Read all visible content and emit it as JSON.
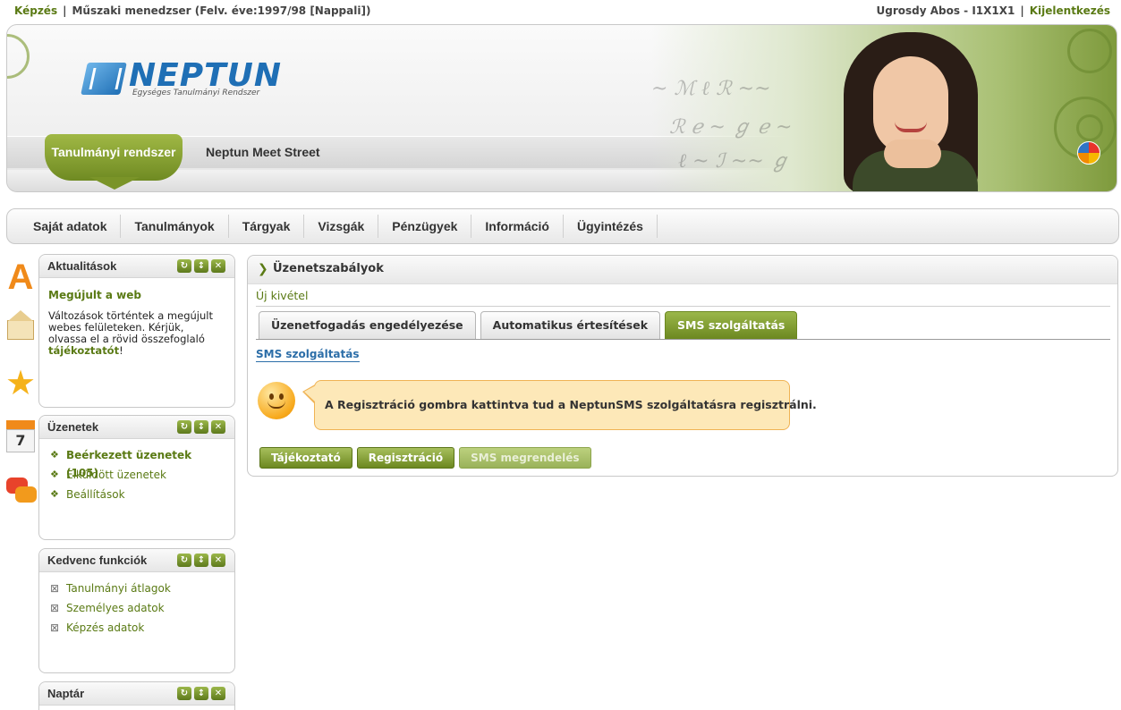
{
  "topbar": {
    "kepzes": "Képzés",
    "program": "Műszaki menedzser (Felv. éve:1997/98 [Nappali])",
    "user": "Ugrosdy Abos - I1X1X1",
    "logout": "Kijelentkezés"
  },
  "header": {
    "logo_text": "NEPTUN",
    "logo_tagline": "Egységes Tanulmányi Rendszer",
    "tab_active": "Tanulmányi rendszer",
    "tab_other": "Neptun Meet Street"
  },
  "menu": [
    "Saját adatok",
    "Tanulmányok",
    "Tárgyak",
    "Vizsgák",
    "Pénzügyek",
    "Információ",
    "Ügyintézés"
  ],
  "news": {
    "title": "Aktualitások",
    "item_title": "Megújult a web",
    "text_before": "Változások történtek a megújult webes felületeken. Kérjük, olvassa el a rövid összefoglaló ",
    "link": "tájékoztatót",
    "text_after": "!"
  },
  "messages": {
    "title": "Üzenetek",
    "items": [
      "Beérkezett üzenetek (105)",
      "Elküldött üzenetek",
      "Beállítások"
    ]
  },
  "favorites": {
    "title": "Kedvenc funkciók",
    "items": [
      "Tanulmányi átlagok",
      "Személyes adatok",
      "Képzés adatok"
    ]
  },
  "calendar": {
    "title": "Naptár"
  },
  "icons": {
    "calendar_day": "7"
  },
  "main": {
    "title": "Üzenetszabályok",
    "new_exception": "Új kivétel",
    "tabs": [
      "Üzenetfogadás engedélyezése",
      "Automatikus értesítések",
      "SMS szolgáltatás"
    ],
    "active_tab": 2,
    "subtitle": "SMS szolgáltatás",
    "info": "A Regisztráció gombra kattintva tud a NeptunSMS szolgáltatásra regisztrálni.",
    "buttons": [
      "Tájékoztató",
      "Regisztráció",
      "SMS megrendelés"
    ]
  },
  "colors": {
    "accent": "#6c8820",
    "link": "#5a7a14",
    "subtitle": "#2c6ea8",
    "bubble": "#fde8b8"
  }
}
